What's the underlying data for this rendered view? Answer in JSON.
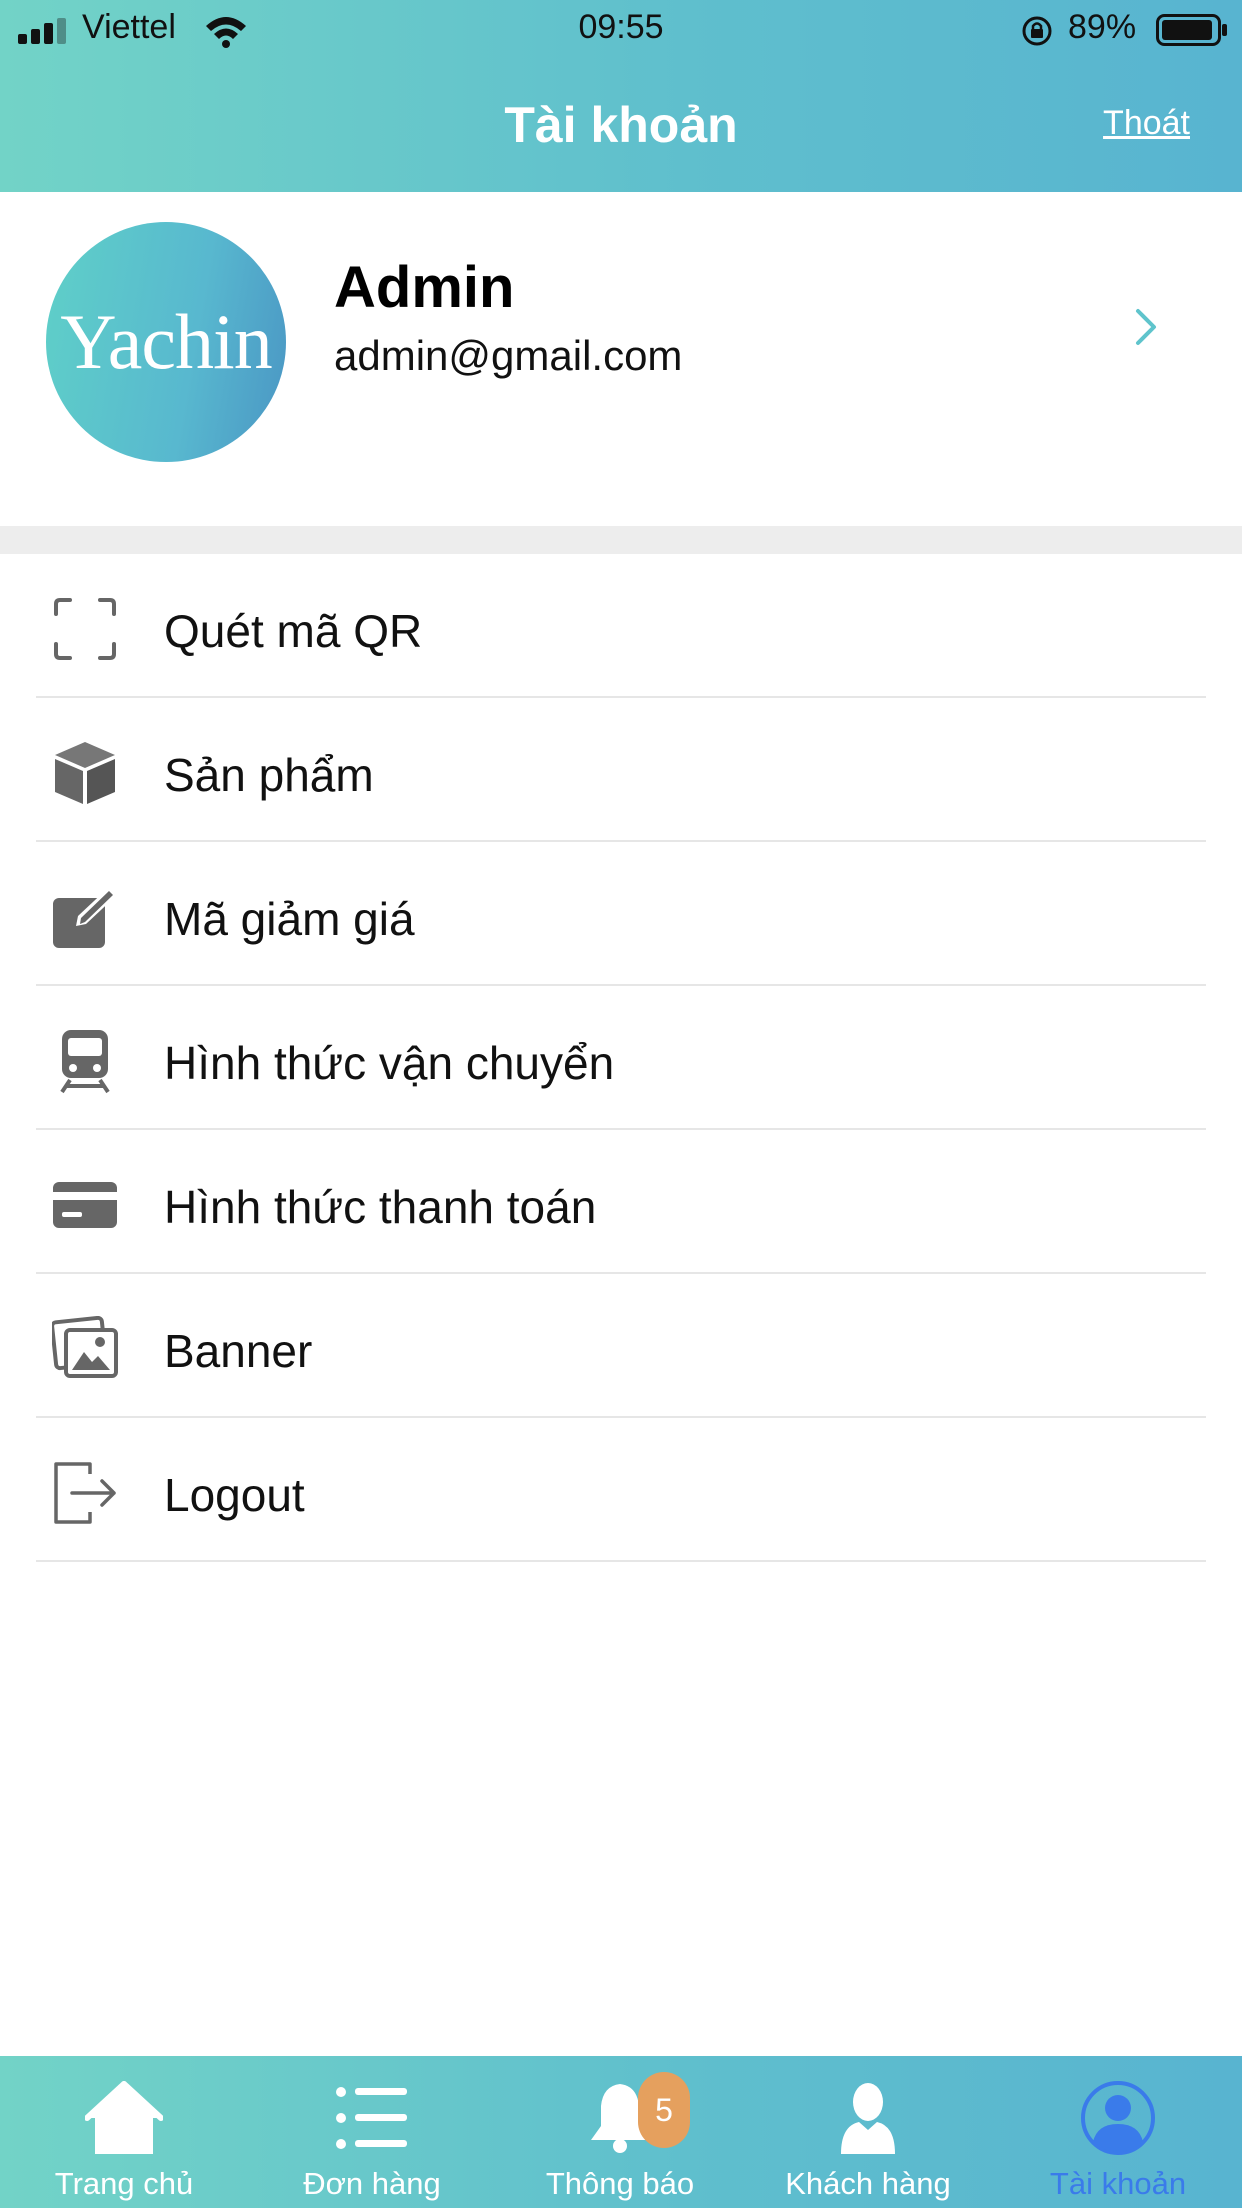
{
  "status_bar": {
    "carrier": "Viettel",
    "time": "09:55",
    "battery": "89%"
  },
  "header": {
    "title": "Tài khoản",
    "logout_link": "Thoát"
  },
  "profile": {
    "avatar_text": "Yachin",
    "name": "Admin",
    "email": "admin@gmail.com"
  },
  "menu": {
    "items": [
      {
        "label": "Quét mã QR",
        "icon": "qr-scan-icon"
      },
      {
        "label": "Sản phẩm",
        "icon": "box-icon"
      },
      {
        "label": "Mã giảm giá",
        "icon": "edit-icon"
      },
      {
        "label": "Hình thức vận chuyển",
        "icon": "train-icon"
      },
      {
        "label": "Hình thức thanh toán",
        "icon": "credit-card-icon"
      },
      {
        "label": "Banner",
        "icon": "images-icon"
      },
      {
        "label": "Logout",
        "icon": "logout-icon"
      }
    ]
  },
  "tabbar": {
    "tabs": [
      {
        "label": "Trang chủ",
        "icon": "home-icon"
      },
      {
        "label": "Đơn hàng",
        "icon": "list-icon"
      },
      {
        "label": "Thông báo",
        "icon": "bell-icon",
        "badge": "5"
      },
      {
        "label": "Khách hàng",
        "icon": "person-icon"
      },
      {
        "label": "Tài khoản",
        "icon": "account-icon",
        "active": true
      }
    ]
  },
  "colors": {
    "header_start": "#72d3c7",
    "header_end": "#58b4d0",
    "active_tab": "#3a7bea",
    "badge": "#e5a05e",
    "icon_gray": "#666666"
  }
}
